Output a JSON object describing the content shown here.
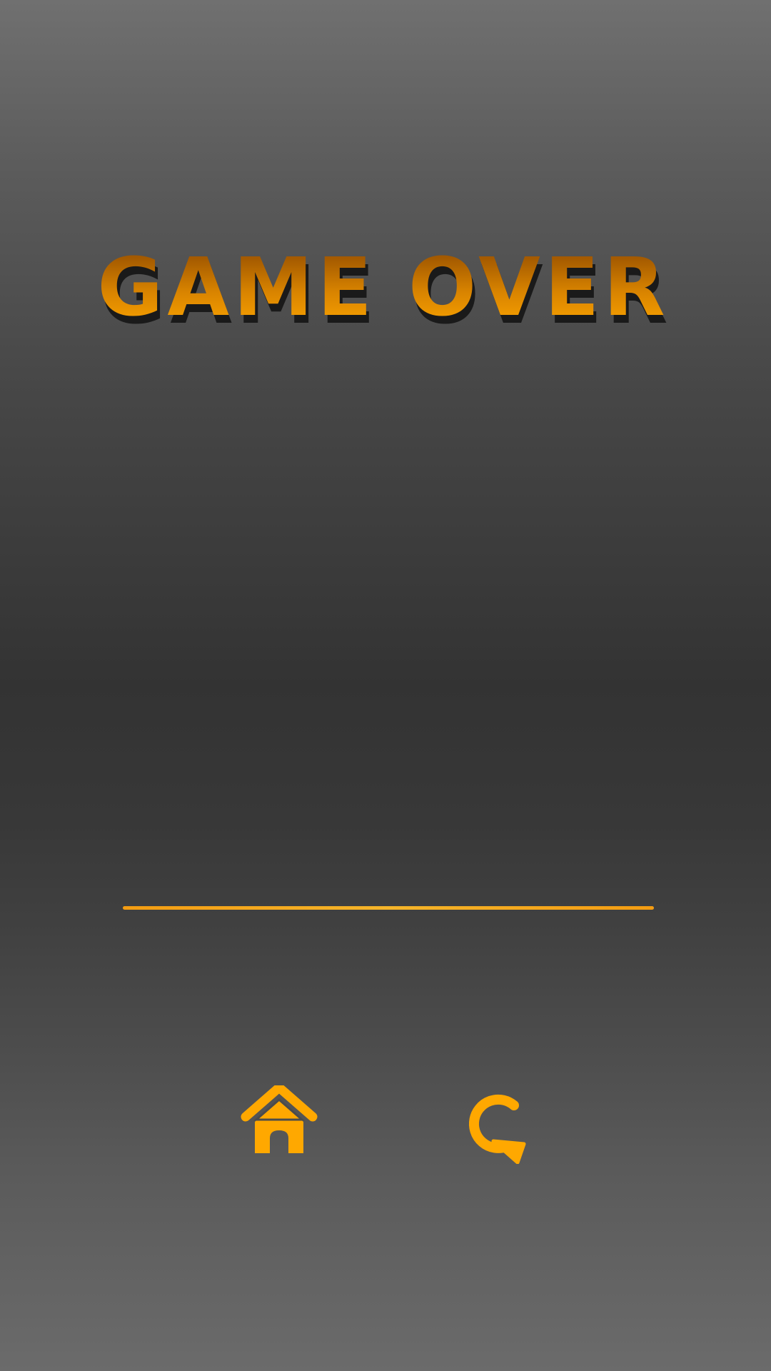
{
  "screen": {
    "title": "GAME OVER"
  },
  "buttons": {
    "home": {
      "icon": "home-icon"
    },
    "restart": {
      "icon": "restart-icon"
    }
  },
  "colors": {
    "accent": "#ffa800",
    "title_top": "#8a4600",
    "title_bottom": "#ffa800",
    "title_shadow": "#1a1a1a",
    "divider": "#f39c12"
  }
}
